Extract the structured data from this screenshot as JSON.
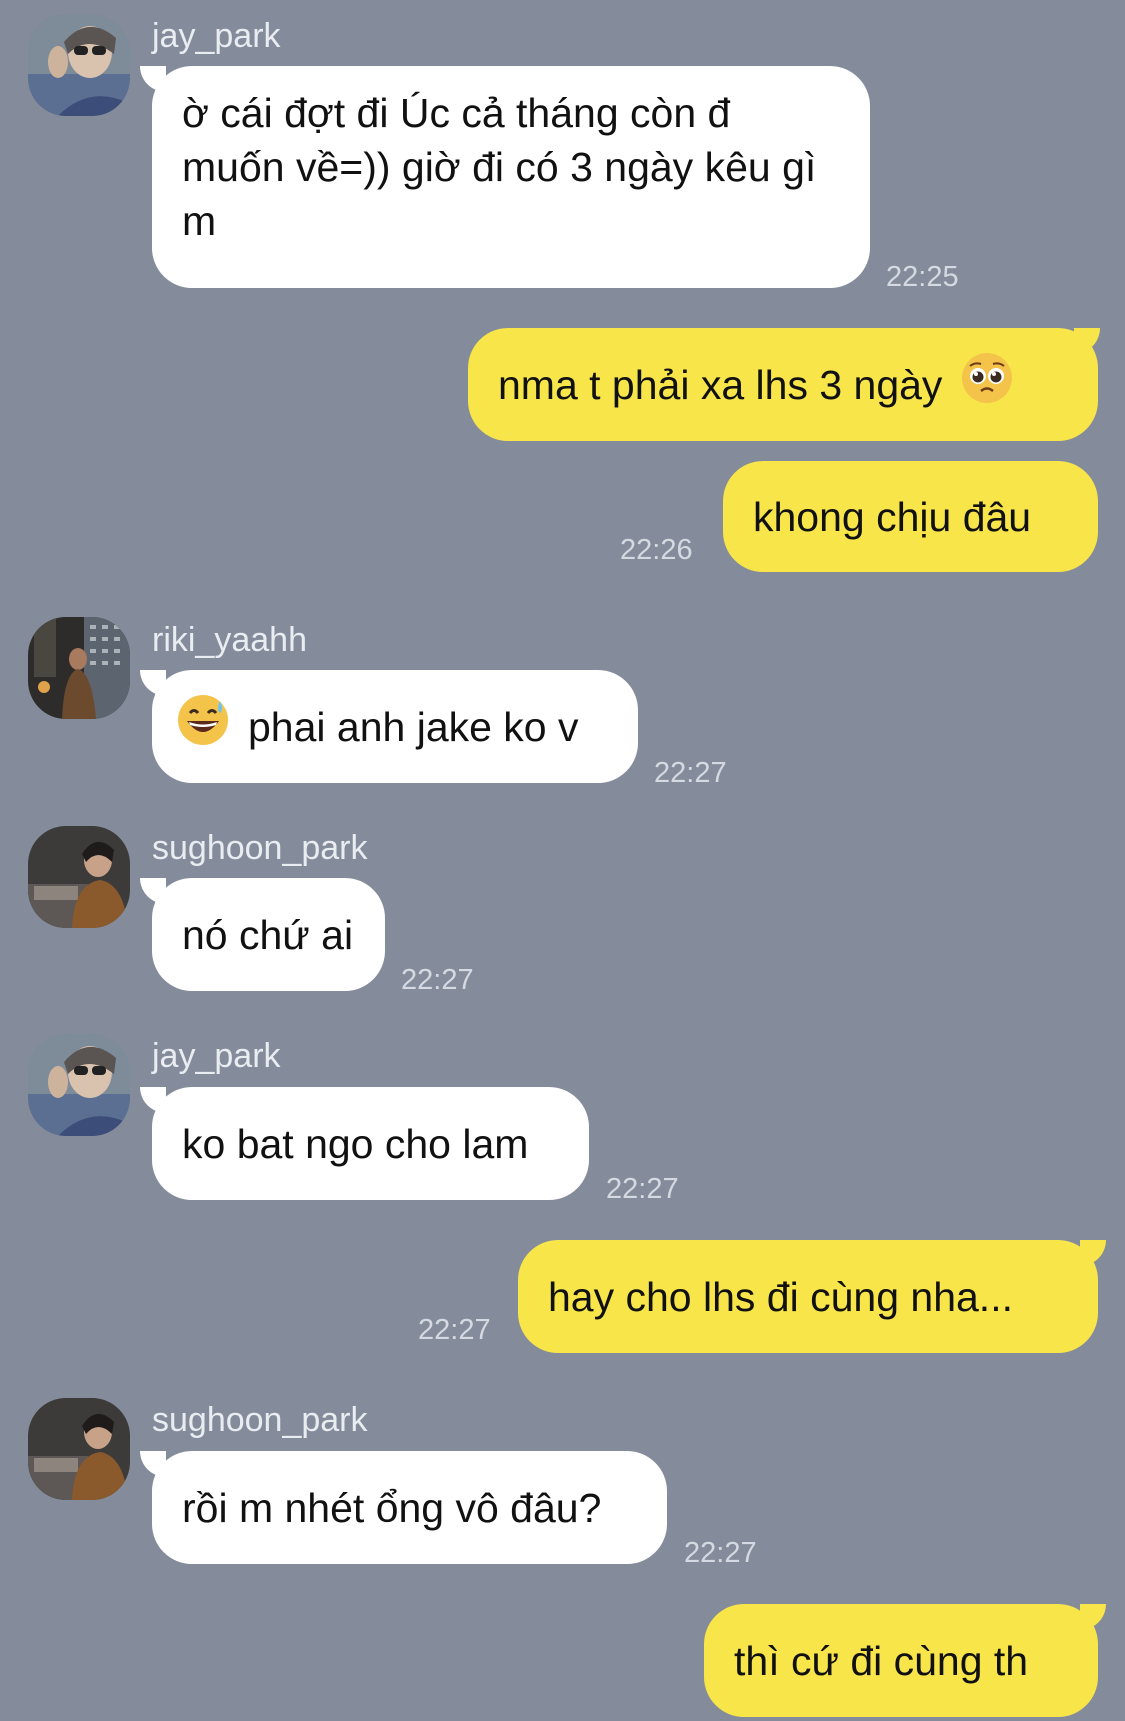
{
  "messages": [
    {
      "sender": "jay_park",
      "text": "ờ cái đợt đi Úc cả tháng còn đ muốn về=)) giờ đi có 3 ngày kêu gì m",
      "time": "22:25",
      "avatar": "jay-avatar"
    },
    {
      "text": "nma t phải xa lhs 3 ngày",
      "emoji": "pleading-face-emoji"
    },
    {
      "text": "khong chịu đâu",
      "time": "22:26"
    },
    {
      "sender": "riki_yaahh",
      "text": "phai anh jake ko v",
      "emoji": "grinning-sweat-emoji",
      "time": "22:27",
      "avatar": "riki-avatar"
    },
    {
      "sender": "sughoon_park",
      "text": "nó chứ ai",
      "time": "22:27",
      "avatar": "sughoon-avatar"
    },
    {
      "sender": "jay_park",
      "text": "ko bat ngo cho lam",
      "time": "22:27",
      "avatar": "jay-avatar"
    },
    {
      "text": "hay cho lhs đi cùng nha...",
      "time": "22:27"
    },
    {
      "sender": "sughoon_park",
      "text": "rồi m nhét ổng vô đâu?",
      "time": "22:27",
      "avatar": "sughoon-avatar"
    },
    {
      "text": "thì cứ đi cùng th"
    }
  ],
  "colors": {
    "background": "#848b9a",
    "incoming_bubble": "#ffffff",
    "outgoing_bubble": "#f7e54a",
    "sender_name": "#e9ecf1",
    "timestamp": "#d5d9e1"
  }
}
